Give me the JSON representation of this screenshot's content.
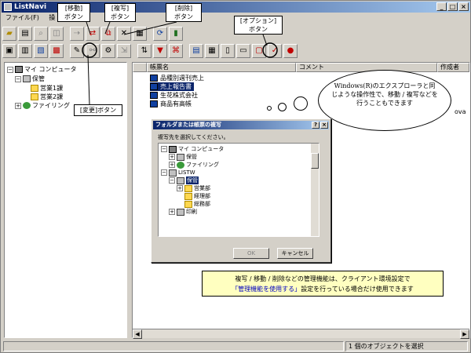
{
  "window": {
    "title": "ListNavi",
    "controls": [
      "_",
      "□",
      "×"
    ]
  },
  "menu": [
    "ファイル(F)",
    "操"
  ],
  "tree": [
    {
      "label": "マイ コンピュータ",
      "expander": "−",
      "icon": "computer-icon"
    },
    {
      "label": "保管",
      "expander": "−",
      "icon": "cabinet-icon"
    },
    {
      "label": "営業1課",
      "expander": "",
      "icon": "folder-icon"
    },
    {
      "label": "営業2課",
      "expander": "",
      "icon": "folder-icon"
    },
    {
      "label": "ファイリング",
      "expander": "+",
      "icon": "filing-icon"
    }
  ],
  "list": {
    "columns": [
      "帳票名",
      "コメント",
      "作成者"
    ],
    "rows": [
      {
        "name": "品種別週刊売上",
        "selected": false
      },
      {
        "name": "売上報告書",
        "selected": true
      },
      {
        "name": "生花株式会社",
        "selected": false
      },
      {
        "name": "商品有高帳",
        "selected": false
      }
    ],
    "partial_cell": "ova"
  },
  "status": {
    "text": "1 個のオブジェクトを選択"
  },
  "callouts": {
    "move": [
      "[移動]",
      "ボタン"
    ],
    "copy": [
      "[複写]",
      "ボタン"
    ],
    "delete": [
      "[削除]",
      "ボタン"
    ],
    "option": [
      "[オプション]",
      "ボタン"
    ],
    "change": "[変更]ボタン"
  },
  "dialog": {
    "title": "フォルダまたは帳票の複写",
    "prompt": "複写先を選択してください。",
    "tree": [
      {
        "label": "マイ コンピュータ",
        "expander": "−"
      },
      {
        "label": "保管",
        "expander": "+"
      },
      {
        "label": "ファイリング",
        "expander": "+"
      },
      {
        "label": "LISTW",
        "expander": "−"
      },
      {
        "label": "保管",
        "expander": "−"
      },
      {
        "label": "営業部",
        "expander": "+"
      },
      {
        "label": "経理部",
        "expander": ""
      },
      {
        "label": "総務部",
        "expander": ""
      },
      {
        "label": "印刷",
        "expander": "+"
      }
    ],
    "ok_label": "OK",
    "cancel_label": "キャンセル",
    "title_controls": [
      "?",
      "×"
    ]
  },
  "bubble": {
    "text": "Windows(R)のエクスプローラと同じような操作性で、移動 / 複写などを行うこともできます"
  },
  "note": {
    "line1": "複写 / 移動 / 削除などの管理機能は、クライアント環境設定で",
    "line2_blue": "「管理機能を使用する」",
    "line2_rest": "設定を行っている場合だけ使用できます"
  },
  "colors": {
    "title_bar": "#0a246a",
    "selection": "#0a246a",
    "note_bg": "#ffffc0"
  }
}
